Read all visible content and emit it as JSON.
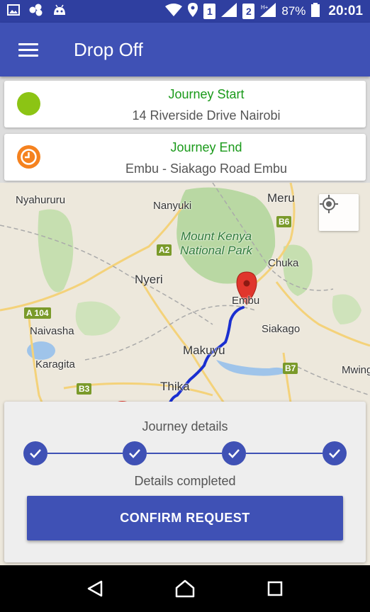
{
  "status_bar": {
    "sim1": "1",
    "sim2": "2",
    "battery": "87%",
    "time": "20:01"
  },
  "app_bar": {
    "title": "Drop Off"
  },
  "journey_start": {
    "title": "Journey Start",
    "address": "14 Riverside Drive Nairobi",
    "dot_color": "#8cc414"
  },
  "journey_end": {
    "title": "Journey End",
    "address": "Embu - Siakago Road Embu",
    "dot_color": "#f5821f"
  },
  "map": {
    "labels": {
      "nyahururu": "Nyahururu",
      "nanyuki": "Nanyuki",
      "meru": "Meru",
      "park": "Mount Kenya\nNational Park",
      "chuka": "Chuka",
      "nyeri": "Nyeri",
      "embu": "Embu",
      "siakago": "Siakago",
      "naivasha": "Naivasha",
      "makuyu": "Makuyu",
      "karagita": "Karagita",
      "mwing": "Mwing",
      "thika": "Thika"
    },
    "roads": {
      "b6": "B6",
      "a2": "A2",
      "a104": "A 104",
      "b7": "B7",
      "b3": "B3"
    },
    "route_color": "#1a2fd0",
    "marker_color": "#e0362c"
  },
  "panel": {
    "title": "Journey details",
    "subtitle": "Details completed",
    "steps_completed": 4,
    "confirm_label": "CONFIRM REQUEST"
  }
}
